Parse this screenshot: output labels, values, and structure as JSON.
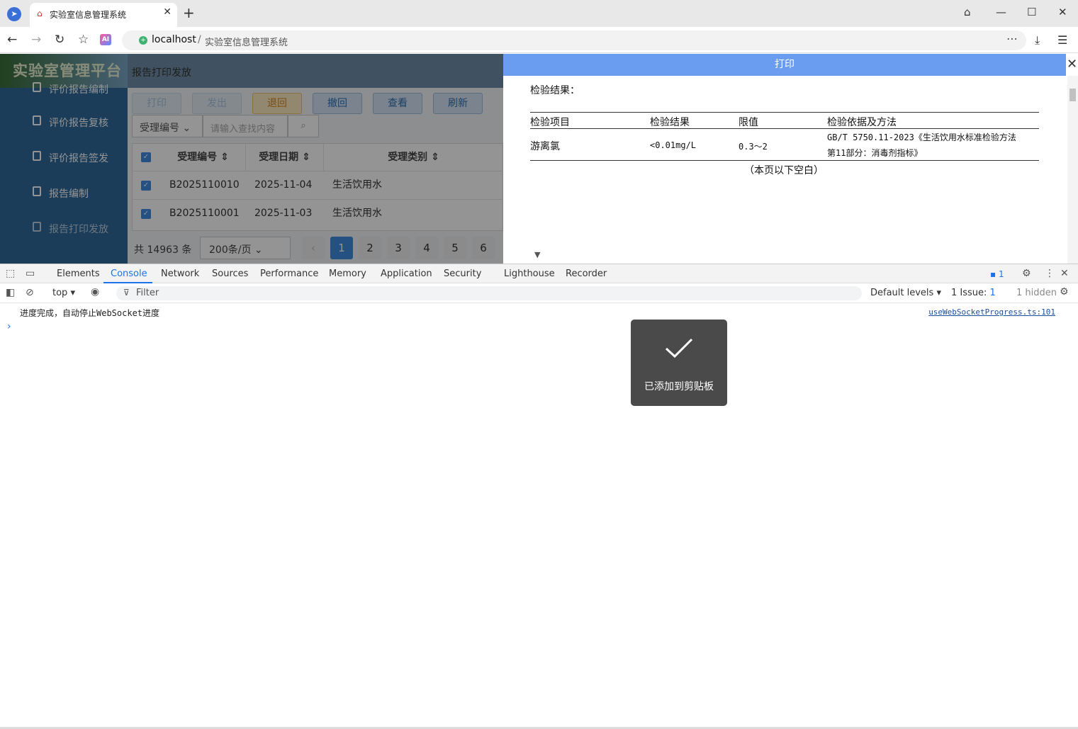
{
  "browser": {
    "tab_title": "实验室信息管理系统",
    "url_host": "localhost",
    "url_sep": "/",
    "url_path": "实验室信息管理系统"
  },
  "app": {
    "logo": "实验室管理平台",
    "breadcrumb": "报告打印发放",
    "sidebar": [
      {
        "label": "评价报告编制"
      },
      {
        "label": "评价报告复核"
      },
      {
        "label": "评价报告签发"
      },
      {
        "label": "报告编制"
      },
      {
        "label": "报告打印发放"
      }
    ],
    "toolbar": {
      "print": "打印",
      "issue": "发出",
      "return": "退回",
      "revoke": "撤回",
      "view": "查看",
      "refresh": "刷新"
    },
    "filter": {
      "field": "受理编号",
      "placeholder": "请输入查找内容"
    },
    "table": {
      "headers": [
        "受理编号",
        "受理日期",
        "受理类别"
      ],
      "rows": [
        {
          "no": "B2025110010",
          "date": "2025-11-04",
          "type": "生活饮用水"
        },
        {
          "no": "B2025110001",
          "date": "2025-11-03",
          "type": "生活饮用水"
        }
      ]
    },
    "pager": {
      "total": "共 14963 条",
      "size": "200条/页",
      "pages": [
        "1",
        "2",
        "3",
        "4",
        "5",
        "6"
      ],
      "current": 1
    }
  },
  "dialog": {
    "title": "打印",
    "section": "检验结果：",
    "columns": [
      "检验项目",
      "检验结果",
      "限值",
      "检验依据及方法"
    ],
    "row": {
      "item": "游离氯",
      "result": "<0.01mg/L",
      "limit": "0.3～2",
      "method_line1": "GB/T 5750.11-2023《生活饮用水标准检验方法",
      "method_line2": "第11部分：消毒剂指标》"
    },
    "blank_note": "（本页以下空白）"
  },
  "devtools": {
    "tabs": [
      "Elements",
      "Console",
      "Network",
      "Sources",
      "Performance",
      "Memory",
      "Application",
      "Security",
      "Lighthouse",
      "Recorder"
    ],
    "active_tab": "Console",
    "issue_badge": "1",
    "context": "top",
    "filter_placeholder": "Filter",
    "levels": "Default levels",
    "issues": "1 Issue:",
    "issues_count": "1",
    "hidden": "1 hidden",
    "message": "进度完成，自动停止WebSocket进度",
    "message_source": "useWebSocketProgress.ts:101"
  },
  "toast": {
    "text": "已添加到剪贴板"
  },
  "colors": {
    "accent": "#3f8ae0",
    "dialog_header": "#6a9df0",
    "sidebar": "#2f6a9c",
    "toast_bg": "#4a4a4a"
  }
}
